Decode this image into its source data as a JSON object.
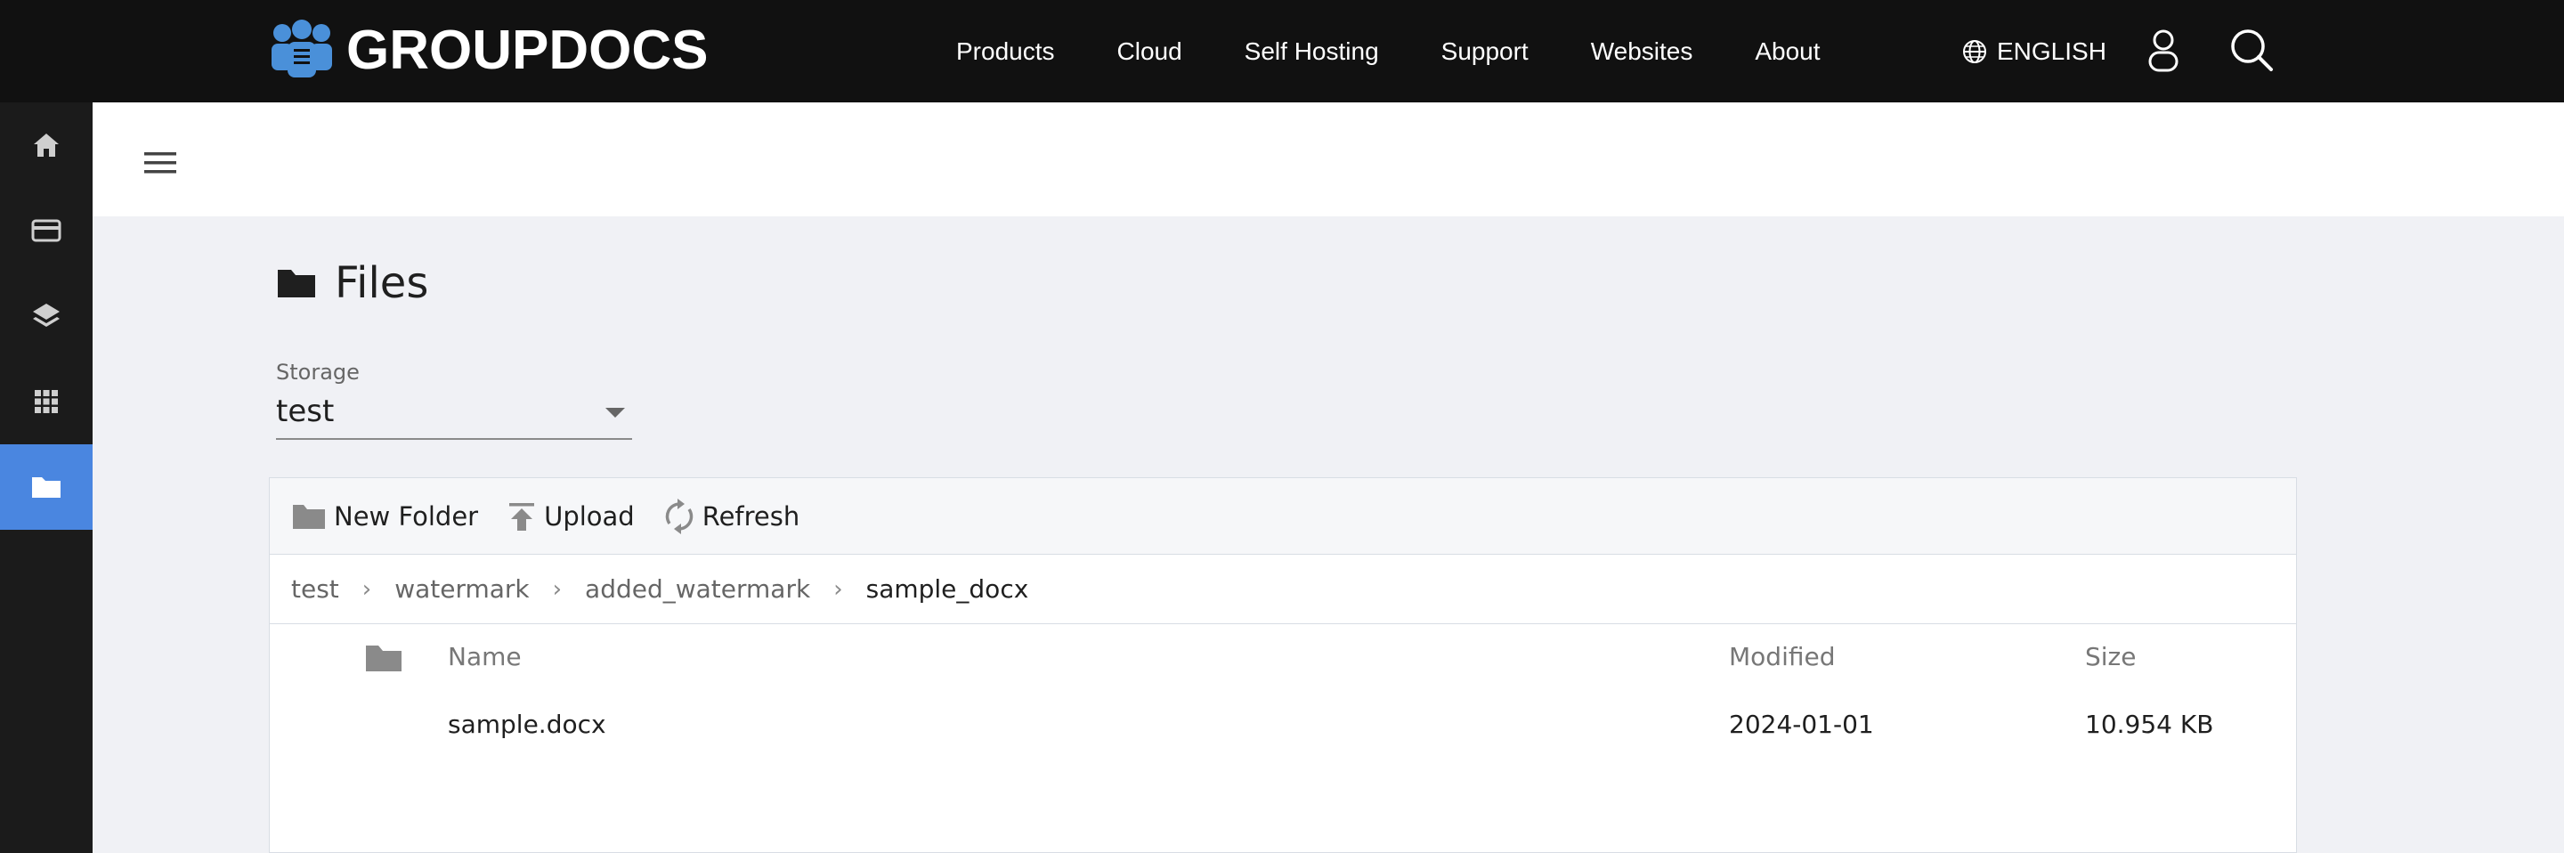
{
  "brand": {
    "name": "GROUPDOCS"
  },
  "nav": {
    "links": [
      "Products",
      "Cloud",
      "Self Hosting",
      "Support",
      "Websites",
      "About"
    ],
    "language": "ENGLISH"
  },
  "rail": {
    "items": [
      "home-icon",
      "card-icon",
      "layers-icon",
      "apps-grid-icon",
      "folder-icon"
    ],
    "active": "folder-icon"
  },
  "page": {
    "title": "Files"
  },
  "storage": {
    "label": "Storage",
    "value": "test"
  },
  "toolbar": {
    "new_folder": "New Folder",
    "upload": "Upload",
    "refresh": "Refresh"
  },
  "breadcrumb": [
    "test",
    "watermark",
    "added_watermark",
    "sample_docx"
  ],
  "table": {
    "headers": {
      "name": "Name",
      "modified": "Modified",
      "size": "Size"
    },
    "rows": [
      {
        "name": "sample.docx",
        "modified": "2024-01-01",
        "size": "10.954 KB"
      }
    ]
  },
  "colors": {
    "accent": "#4a86e0",
    "topbar": "#111111",
    "rail": "#1b1b1b",
    "background": "#f0f1f5"
  }
}
